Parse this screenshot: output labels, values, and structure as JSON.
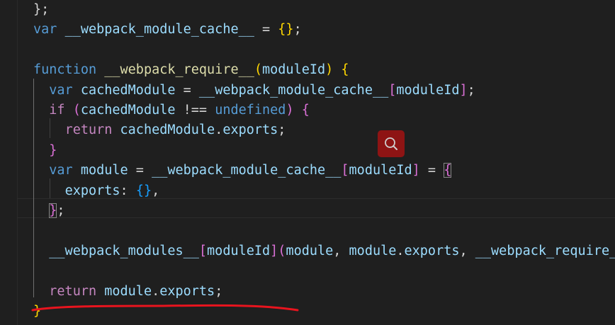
{
  "editor": {
    "lines": [
      [
        [
          "pun",
          "};"
        ]
      ],
      [
        [
          "kw",
          "var"
        ],
        [
          "pun",
          " "
        ],
        [
          "var",
          "__webpack_module_cache__"
        ],
        [
          "pun",
          " = "
        ],
        [
          "b1",
          "{}"
        ],
        [
          "pun",
          ";"
        ]
      ],
      [],
      [
        [
          "kw",
          "function"
        ],
        [
          "pun",
          " "
        ],
        [
          "fn",
          "__webpack_require__"
        ],
        [
          "b1",
          "("
        ],
        [
          "var",
          "moduleId"
        ],
        [
          "b1",
          ")"
        ],
        [
          "pun",
          " "
        ],
        [
          "b1",
          "{"
        ]
      ],
      [
        [
          "pun",
          "  "
        ],
        [
          "kw",
          "var"
        ],
        [
          "pun",
          " "
        ],
        [
          "var",
          "cachedModule"
        ],
        [
          "pun",
          " = "
        ],
        [
          "var",
          "__webpack_module_cache__"
        ],
        [
          "b2",
          "["
        ],
        [
          "var",
          "moduleId"
        ],
        [
          "b2",
          "]"
        ],
        [
          "pun",
          ";"
        ]
      ],
      [
        [
          "pun",
          "  "
        ],
        [
          "ctl",
          "if"
        ],
        [
          "pun",
          " "
        ],
        [
          "b2",
          "("
        ],
        [
          "var",
          "cachedModule"
        ],
        [
          "pun",
          " !== "
        ],
        [
          "kw",
          "undefined"
        ],
        [
          "b2",
          ")"
        ],
        [
          "pun",
          " "
        ],
        [
          "b2",
          "{"
        ]
      ],
      [
        [
          "pun",
          "    "
        ],
        [
          "ctl",
          "return"
        ],
        [
          "pun",
          " "
        ],
        [
          "var",
          "cachedModule"
        ],
        [
          "pun",
          "."
        ],
        [
          "var",
          "exports"
        ],
        [
          "pun",
          ";"
        ]
      ],
      [
        [
          "pun",
          "  "
        ],
        [
          "b2",
          "}"
        ]
      ],
      [
        [
          "pun",
          "  "
        ],
        [
          "kw",
          "var"
        ],
        [
          "pun",
          " "
        ],
        [
          "var",
          "module"
        ],
        [
          "pun",
          " = "
        ],
        [
          "var",
          "__webpack_module_cache__"
        ],
        [
          "b2",
          "["
        ],
        [
          "var",
          "moduleId"
        ],
        [
          "b2",
          "]"
        ],
        [
          "pun",
          " = "
        ],
        [
          "b2 bm",
          "{"
        ]
      ],
      [
        [
          "pun",
          "    "
        ],
        [
          "var",
          "exports"
        ],
        [
          "pun",
          ": "
        ],
        [
          "b3",
          "{}"
        ],
        [
          "pun",
          ","
        ]
      ],
      [
        [
          "pun",
          "  "
        ],
        [
          "b2 bm",
          "}"
        ],
        [
          "pun",
          ";"
        ]
      ],
      [],
      [
        [
          "pun",
          "  "
        ],
        [
          "var",
          "__webpack_modules__"
        ],
        [
          "b2",
          "["
        ],
        [
          "var",
          "moduleId"
        ],
        [
          "b2",
          "]"
        ],
        [
          "b2",
          "("
        ],
        [
          "var",
          "module"
        ],
        [
          "pun",
          ", "
        ],
        [
          "var",
          "module"
        ],
        [
          "pun",
          "."
        ],
        [
          "var",
          "exports"
        ],
        [
          "pun",
          ", "
        ],
        [
          "var",
          "__webpack_require__"
        ],
        [
          "b2",
          ")"
        ],
        [
          "pun",
          ";"
        ]
      ],
      [],
      [
        [
          "pun",
          "  "
        ],
        [
          "ctl",
          "return"
        ],
        [
          "pun",
          " "
        ],
        [
          "var",
          "module"
        ],
        [
          "pun",
          "."
        ],
        [
          "var",
          "exports"
        ],
        [
          "pun",
          ";"
        ]
      ],
      [
        [
          "b1",
          "}"
        ]
      ]
    ]
  },
  "search_button": {
    "icon": "search-icon"
  },
  "annotation": {
    "type": "red-underline",
    "color": "#e8141e"
  }
}
